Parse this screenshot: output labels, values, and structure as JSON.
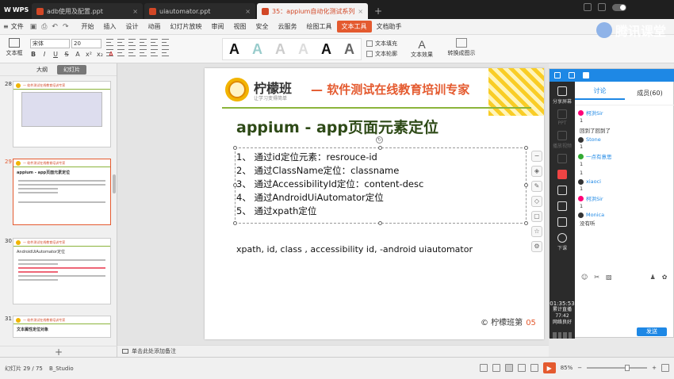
{
  "app": {
    "name": "WPS",
    "tabs": [
      {
        "label": "adb使用及配置.ppt",
        "active": false
      },
      {
        "label": "uiautomator.ppt",
        "active": false
      },
      {
        "label": "35：appium自动化测试系列",
        "active": true
      }
    ]
  },
  "watermark": "腾讯课堂",
  "menu": {
    "file_label": "文件",
    "items": [
      "开始",
      "插入",
      "设计",
      "动画",
      "幻灯片放映",
      "审阅",
      "视图",
      "安全",
      "云服务",
      "绘图工具",
      "文本工具",
      "文档助手"
    ],
    "active": "文本工具"
  },
  "ribbon": {
    "textbox_label": "文本框",
    "font_name": "宋体",
    "font_size": "20",
    "format_buttons": [
      "B",
      "I",
      "U",
      "S",
      "A",
      "x²",
      "x₂",
      "A"
    ],
    "style_samples": [
      "A",
      "A",
      "A",
      "A",
      "A",
      "A"
    ],
    "text_fill": "文本填充",
    "text_outline": "文本轮廓",
    "text_effect": "文本效果",
    "convert": "转换成图示"
  },
  "leftpanel": {
    "tabs": [
      "大纲",
      "幻灯片"
    ],
    "active_tab": "幻灯片",
    "thumbs": [
      {
        "num": "28",
        "title": "",
        "selected": false
      },
      {
        "num": "29",
        "title": "appium - app页面元素定位",
        "selected": true
      },
      {
        "num": "30",
        "title": "AndroidUiAutomator定位",
        "selected": false
      },
      {
        "num": "31",
        "title": "文本属性定位对象",
        "selected": false
      }
    ]
  },
  "slide": {
    "brand": "柠檬班",
    "brand_sub": "让学习变得简单",
    "slogan": "— 软件测试在线教育培训专家",
    "title": "appium - app页面元素定位",
    "list": [
      "1、 通过id定位元素：resrouce-id",
      "2、 通过ClassName定位：classname",
      "3、 通过AccessibilityId定位：content-desc",
      "4、 通过AndroidUiAutomator定位",
      "5、 通过xpath定位"
    ],
    "xpath_line": "xpath, id, class , accessibility id, -android uiautomator",
    "footer": "© 柠檬班第",
    "footer_page": "05"
  },
  "notes_placeholder": "单击此处添加备注",
  "status": {
    "slide_count": "幻灯片 29 / 75",
    "theme": "B_Studio",
    "zoom": "85%"
  },
  "classroom": {
    "tabs": [
      "讨论",
      "成员(60)"
    ],
    "active_tab": "讨论",
    "side_items": [
      "分享屏幕",
      "PPT",
      "播放视频",
      "",
      "",
      "",
      "下课"
    ],
    "timer": "01:35:53",
    "timer_sub1": "累计直播",
    "timer_sub2": "77:42",
    "timer_sub3": "网络良好",
    "messages": [
      {
        "user": "柯洪Sir",
        "text": "1"
      },
      {
        "user": "",
        "text": "回到了回到了"
      },
      {
        "user": "Stone",
        "text": "1"
      },
      {
        "user": "一点有意思",
        "text": "1"
      },
      {
        "user": "",
        "text": "1"
      },
      {
        "user": "xiaoci",
        "text": "1"
      },
      {
        "user": "柯洪Sir",
        "text": "1"
      },
      {
        "user": "Monica",
        "text": "没有听"
      }
    ],
    "send_label": "发送"
  }
}
